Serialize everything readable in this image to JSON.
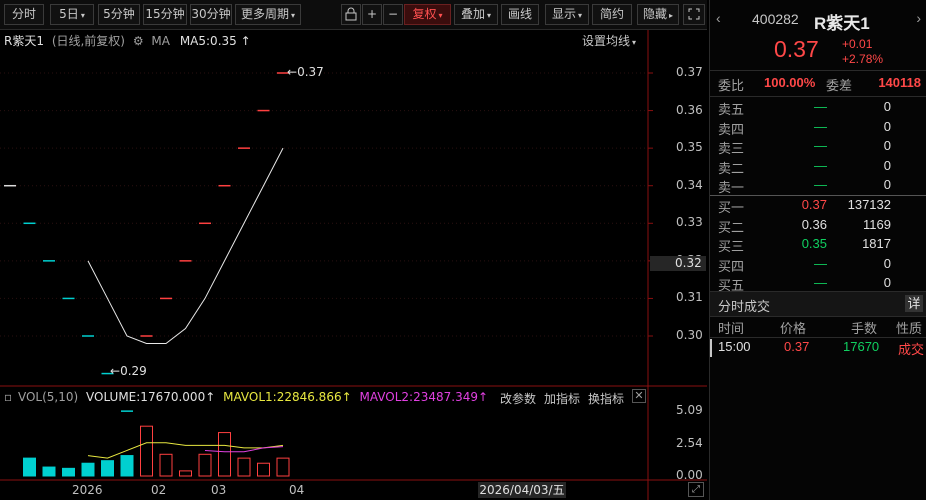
{
  "toolbar": {
    "buttons": [
      {
        "label": "分时",
        "caret": false
      },
      {
        "label": "5日",
        "caret": true
      },
      {
        "label": "5分钟",
        "caret": false
      },
      {
        "label": "15分钟",
        "caret": false
      },
      {
        "label": "30分钟",
        "caret": false
      },
      {
        "label": "更多周期",
        "caret": true
      }
    ],
    "restore_label": "复权",
    "overlay_label": "叠加",
    "draw_label": "画线",
    "display_label": "显示",
    "simple_label": "简约",
    "hide_label": "隐藏",
    "plus": "+",
    "minus": "−",
    "lock_icon": "lock-icon",
    "expand_icon": "expand-icon"
  },
  "chart_header": {
    "name": "R紫天1",
    "period_info": "(日线,前复权)",
    "ma_label": "MA",
    "ma5": "MA5:0.35",
    "settings_label": "设置均线"
  },
  "volume_header": {
    "vol_label": "VOL(5,10)",
    "volume": "VOLUME:17670.000",
    "mavol1": "MAVOL1:22846.866",
    "mavol2": "MAVOL2:23487.349",
    "modify_params": "改参数",
    "add_indicator": "加指标",
    "switch_indicator": "换指标"
  },
  "annotations": {
    "high": "0.37",
    "low": "0.29"
  },
  "price_axis": [
    "0.37",
    "0.36",
    "0.35",
    "0.34",
    "0.33",
    "0.32",
    "0.31",
    "0.30"
  ],
  "current_price_label": "0.32",
  "volume_axis": [
    "5.09",
    "2.54",
    "0.00"
  ],
  "x_axis": [
    "2026",
    "02",
    "03",
    "04"
  ],
  "cursor_date": "2026/04/03/五",
  "chart_data": {
    "type": "candlestick",
    "series": [
      {
        "x": 1,
        "open": 0.34,
        "close": 0.34,
        "color": "#dcdcdc",
        "volume": 0.0
      },
      {
        "x": 2,
        "open": 0.33,
        "close": 0.33,
        "color": "#00d0d0",
        "volume": 1.4
      },
      {
        "x": 3,
        "open": 0.32,
        "close": 0.32,
        "color": "#00d0d0",
        "volume": 0.7
      },
      {
        "x": 4,
        "open": 0.31,
        "close": 0.31,
        "color": "#00d0d0",
        "volume": 0.6
      },
      {
        "x": 5,
        "open": 0.3,
        "close": 0.3,
        "color": "#00d0d0",
        "volume": 1.0
      },
      {
        "x": 6,
        "open": 0.29,
        "close": 0.29,
        "color": "#00d0d0",
        "volume": 1.2
      },
      {
        "x": 7,
        "open": 0.28,
        "close": 0.28,
        "color": "#00d0d0",
        "volume": 1.6
      },
      {
        "x": 8,
        "open": 0.3,
        "close": 0.3,
        "color": "#ff4040",
        "volume": 3.9
      },
      {
        "x": 9,
        "open": 0.31,
        "close": 0.31,
        "color": "#ff4040",
        "volume": 1.7
      },
      {
        "x": 10,
        "open": 0.32,
        "close": 0.32,
        "color": "#ff4040",
        "volume": 0.4
      },
      {
        "x": 11,
        "open": 0.33,
        "close": 0.33,
        "color": "#ff4040",
        "volume": 1.7
      },
      {
        "x": 12,
        "open": 0.34,
        "close": 0.34,
        "color": "#ff4040",
        "volume": 3.4
      },
      {
        "x": 13,
        "open": 0.35,
        "close": 0.35,
        "color": "#ff4040",
        "volume": 1.4
      },
      {
        "x": 14,
        "open": 0.36,
        "close": 0.36,
        "color": "#ff4040",
        "volume": 1.0
      },
      {
        "x": 15,
        "open": 0.37,
        "close": 0.37,
        "color": "#ff4040",
        "volume": 1.4
      }
    ],
    "ma5": [
      null,
      null,
      null,
      null,
      0.32,
      0.31,
      0.3,
      0.298,
      0.298,
      0.302,
      0.31,
      0.32,
      0.33,
      0.34,
      0.35
    ],
    "mavol1": [
      null,
      null,
      null,
      null,
      1.6,
      1.4,
      2.0,
      2.6,
      2.6,
      2.4,
      2.4,
      2.4,
      2.2,
      2.2,
      2.4
    ],
    "mavol2": [
      null,
      null,
      null,
      null,
      null,
      null,
      null,
      null,
      null,
      null,
      2.0,
      1.9,
      1.9,
      2.2,
      2.3
    ],
    "ylim": [
      0.28,
      0.38
    ],
    "vol_ylim": [
      0,
      5.09
    ]
  },
  "quote": {
    "code": "400282",
    "name": "R紫天1",
    "price": "0.37",
    "change": "+0.01",
    "change_pct": "+2.78%",
    "weibi_label": "委比",
    "weibi": "100.00%",
    "weicha_label": "委差",
    "weicha": "140118",
    "asks": [
      {
        "label": "卖五",
        "price": "—",
        "vol": "0"
      },
      {
        "label": "卖四",
        "price": "—",
        "vol": "0"
      },
      {
        "label": "卖三",
        "price": "—",
        "vol": "0"
      },
      {
        "label": "卖二",
        "price": "—",
        "vol": "0"
      },
      {
        "label": "卖一",
        "price": "—",
        "vol": "0"
      }
    ],
    "bids": [
      {
        "label": "买一",
        "price": "0.37",
        "vol": "137132",
        "color": "red"
      },
      {
        "label": "买二",
        "price": "0.36",
        "vol": "1169",
        "color": "white"
      },
      {
        "label": "买三",
        "price": "0.35",
        "vol": "1817",
        "color": "green"
      },
      {
        "label": "买四",
        "price": "—",
        "vol": "0",
        "color": "green"
      },
      {
        "label": "买五",
        "price": "—",
        "vol": "0",
        "color": "green"
      }
    ],
    "trades_title": "分时成交",
    "detail_label": "详",
    "trade_headers": [
      "时间",
      "价格",
      "手数",
      "性质"
    ],
    "trades": [
      {
        "time": "15:00",
        "price": "0.37",
        "volume": "17670",
        "type": "成交"
      }
    ]
  }
}
